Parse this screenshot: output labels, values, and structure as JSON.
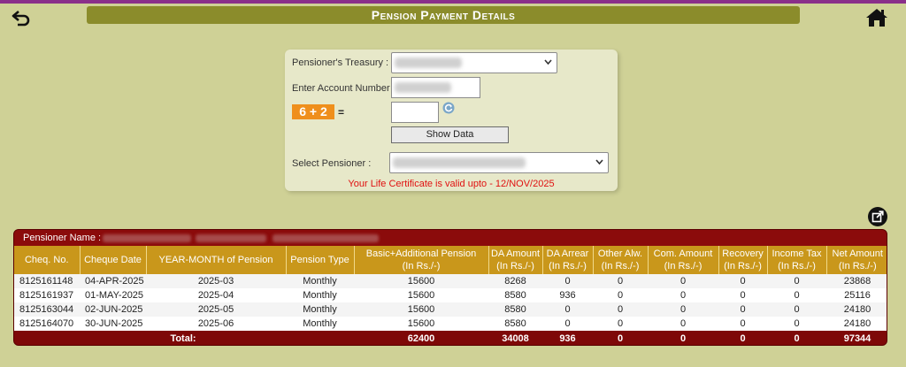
{
  "header": {
    "title": "Pension Payment Details"
  },
  "form": {
    "treasury_label": "Pensioner's Treasury :",
    "account_label": "Enter Account Number",
    "captcha_text": "6 + 2",
    "captcha_equals": "=",
    "show_button": "Show Data",
    "pensioner_label": "Select Pensioner :",
    "lc_message": "Your Life Certificate is valid upto - 12/NOV/2025"
  },
  "table": {
    "pensioner_name_label": "Pensioner Name :",
    "headers": [
      "Cheq. No.",
      "Cheque Date",
      "YEAR-MONTH of Pension",
      "Pension Type",
      "Basic+Additional Pension\n(In Rs./-)",
      "DA Amount\n(In Rs./-)",
      "DA Arrear\n(In Rs./-)",
      "Other Alw.\n(In Rs./-)",
      "Com. Amount\n(In Rs./-)",
      "Recovery\n(In Rs./-)",
      "Income Tax\n(In Rs./-)",
      "Net Amount\n(In Rs./-)"
    ],
    "rows": [
      [
        "8125161148",
        "04-APR-2025",
        "2025-03",
        "Monthly",
        "15600",
        "8268",
        "0",
        "0",
        "0",
        "0",
        "0",
        "23868"
      ],
      [
        "8125161937",
        "01-MAY-2025",
        "2025-04",
        "Monthly",
        "15600",
        "8580",
        "936",
        "0",
        "0",
        "0",
        "0",
        "25116"
      ],
      [
        "8125163044",
        "02-JUN-2025",
        "2025-05",
        "Monthly",
        "15600",
        "8580",
        "0",
        "0",
        "0",
        "0",
        "0",
        "24180"
      ],
      [
        "8125164070",
        "30-JUN-2025",
        "2025-06",
        "Monthly",
        "15600",
        "8580",
        "0",
        "0",
        "0",
        "0",
        "0",
        "24180"
      ]
    ],
    "total_label": "Total:",
    "totals": [
      "62400",
      "34008",
      "936",
      "0",
      "0",
      "0",
      "0",
      "97344"
    ]
  },
  "colors": {
    "background": "#cfd196",
    "title_bar": "#8b8c2b",
    "header_gold": "#c9971b",
    "maroon": "#7e0808",
    "captcha": "#ef8f1c",
    "alert_red": "#e01010"
  },
  "icons": {
    "back": "back-arrow-icon",
    "home": "home-icon",
    "refresh": "refresh-icon",
    "export": "export-icon"
  }
}
